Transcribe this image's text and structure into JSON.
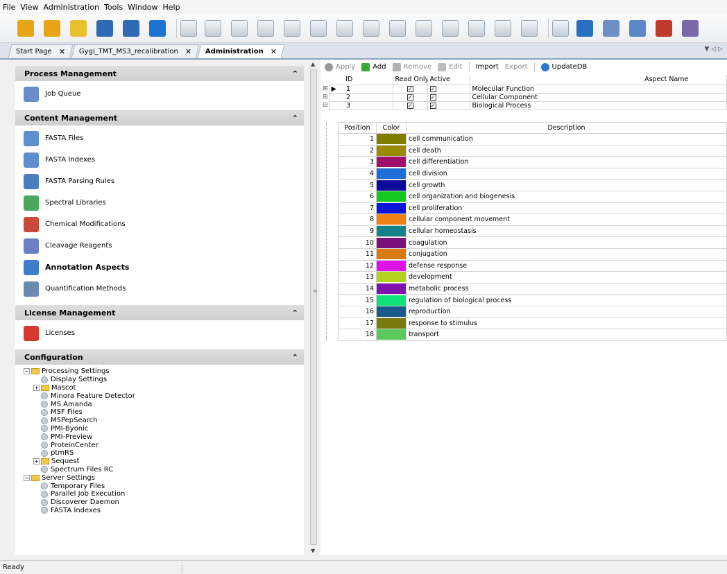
{
  "menu": [
    "File",
    "View",
    "Administration",
    "Tools",
    "Window",
    "Help"
  ],
  "toolbar_icons": [
    {
      "name": "open-study-icon",
      "color": "#e8a317"
    },
    {
      "name": "open-result-icon",
      "color": "#e8a317"
    },
    {
      "name": "open-folder-icon",
      "color": "#e8c030"
    },
    {
      "name": "save-icon",
      "color": "#2f6bb5"
    },
    {
      "name": "save-all-icon",
      "color": "#2f6bb5"
    },
    {
      "name": "home-icon",
      "color": "#1e73d2"
    },
    {
      "name": "calculator-icon",
      "color": "gray"
    },
    {
      "name": "filter-icon",
      "color": "gray"
    },
    {
      "name": "chart-1-icon",
      "color": "gray"
    },
    {
      "name": "chart-2-icon",
      "color": "gray"
    },
    {
      "name": "chart-3-icon",
      "color": "gray"
    },
    {
      "name": "eye-icon",
      "color": "gray"
    },
    {
      "name": "chart-4-icon",
      "color": "gray"
    },
    {
      "name": "chart-5-icon",
      "color": "gray"
    },
    {
      "name": "chart-6-icon",
      "color": "gray"
    },
    {
      "name": "chart-7-icon",
      "color": "gray"
    },
    {
      "name": "chart-8-icon",
      "color": "gray"
    },
    {
      "name": "chart-9-icon",
      "color": "gray"
    },
    {
      "name": "chart-10-icon",
      "color": "gray"
    },
    {
      "name": "chart-11-icon",
      "color": "gray"
    },
    {
      "name": "document-icon",
      "color": "gray"
    },
    {
      "name": "workflow-icon",
      "color": "#2a6fbf"
    },
    {
      "name": "job-queue-icon",
      "color": "#6d8fc7"
    },
    {
      "name": "fasta-files-icon",
      "color": "#5a88c8"
    },
    {
      "name": "chemical-mods-icon",
      "color": "#c0392b"
    },
    {
      "name": "cleavage-icon",
      "color": "#7a6aa8"
    }
  ],
  "tabs": [
    {
      "label": "Start Page",
      "active": false
    },
    {
      "label": "Gygi_TMT_MS3_recalibration",
      "active": false
    },
    {
      "label": "Administration",
      "active": true
    }
  ],
  "tab_close": "✕",
  "tab_nav": "▼ ◁ ▷",
  "collapse_glyph": "⌃",
  "sections": [
    {
      "title": "Process Management",
      "items": [
        {
          "label": "Job Queue",
          "icon": "job-queue-icon",
          "color": "#6a8cc9",
          "bold": false
        }
      ]
    },
    {
      "title": "Content Management",
      "items": [
        {
          "label": "FASTA Files",
          "icon": "fasta-files-icon",
          "color": "#5b8fd0",
          "bold": false
        },
        {
          "label": "FASTA Indexes",
          "icon": "fasta-indexes-icon",
          "color": "#5b8fd0",
          "bold": false
        },
        {
          "label": "FASTA Parsing Rules",
          "icon": "parsing-rules-icon",
          "color": "#4a7fbf",
          "bold": false
        },
        {
          "label": "Spectral Libraries",
          "icon": "spectral-libraries-icon",
          "color": "#4aa85c",
          "bold": false
        },
        {
          "label": "Chemical Modifications",
          "icon": "chemical-modifications-icon",
          "color": "#c94a3a",
          "bold": false
        },
        {
          "label": "Cleavage Reagents",
          "icon": "cleavage-reagents-icon",
          "color": "#6b7fc4",
          "bold": false
        },
        {
          "label": "Annotation Aspects",
          "icon": "annotation-aspects-icon",
          "color": "#3c7fc8",
          "bold": true
        },
        {
          "label": "Quantification Methods",
          "icon": "quantification-methods-icon",
          "color": "#6a8ab0",
          "bold": false
        }
      ]
    },
    {
      "title": "License Management",
      "items": [
        {
          "label": "Licenses",
          "icon": "licenses-ribbon-icon",
          "color": "#d63a2a",
          "bold": false
        }
      ]
    }
  ],
  "configuration": {
    "title": "Configuration",
    "tree": [
      {
        "label": "Processing Settings",
        "level": 0,
        "type": "folder",
        "expander": "⊟"
      },
      {
        "label": "Display Settings",
        "level": 1,
        "type": "gear",
        "expander": ""
      },
      {
        "label": "Mascot",
        "level": 1,
        "type": "folder",
        "expander": "⊞"
      },
      {
        "label": "Minora Feature Detector",
        "level": 1,
        "type": "gear",
        "expander": ""
      },
      {
        "label": "MS Amanda",
        "level": 1,
        "type": "gear",
        "expander": ""
      },
      {
        "label": "MSF Files",
        "level": 1,
        "type": "gear",
        "expander": ""
      },
      {
        "label": "MSPepSearch",
        "level": 1,
        "type": "gear",
        "expander": ""
      },
      {
        "label": "PMI-Byonic",
        "level": 1,
        "type": "gear",
        "expander": ""
      },
      {
        "label": "PMI-Preview",
        "level": 1,
        "type": "gear",
        "expander": ""
      },
      {
        "label": "ProteinCenter",
        "level": 1,
        "type": "gear",
        "expander": ""
      },
      {
        "label": "ptmRS",
        "level": 1,
        "type": "gear",
        "expander": ""
      },
      {
        "label": "Sequest",
        "level": 1,
        "type": "folder",
        "expander": "⊞"
      },
      {
        "label": "Spectrum Files RC",
        "level": 1,
        "type": "gear",
        "expander": ""
      },
      {
        "label": "Server Settings",
        "level": 0,
        "type": "folder",
        "expander": "⊟"
      },
      {
        "label": "Temporary Files",
        "level": 1,
        "type": "gear",
        "expander": ""
      },
      {
        "label": "Parallel Job Execution",
        "level": 1,
        "type": "gear",
        "expander": ""
      },
      {
        "label": "Discoverer Daemon",
        "level": 1,
        "type": "gear",
        "expander": ""
      },
      {
        "label": "FASTA Indexes",
        "level": 1,
        "type": "gear",
        "expander": ""
      }
    ]
  },
  "right_toolbar": {
    "apply": "Apply",
    "add": "Add",
    "remove": "Remove",
    "edit": "Edit",
    "import": "Import",
    "export": "Export",
    "updatedb": "UpdateDB"
  },
  "aspects_grid": {
    "headers": {
      "id": "ID",
      "read_only": "Read Only",
      "active": "Active",
      "aspect_name": "Aspect Name"
    },
    "rows": [
      {
        "expander": "⊞",
        "id": "1",
        "read_only": true,
        "active": true,
        "name": "Molecular Function",
        "current": true
      },
      {
        "expander": "⊞",
        "id": "2",
        "read_only": true,
        "active": true,
        "name": "Cellular Component",
        "current": false
      },
      {
        "expander": "⊟",
        "id": "3",
        "read_only": true,
        "active": true,
        "name": "Biological Process",
        "current": false
      }
    ],
    "check_glyph": "✓",
    "current_glyph": "▶"
  },
  "detail_grid": {
    "headers": {
      "position": "Position",
      "color": "Color",
      "description": "Description"
    },
    "rows": [
      {
        "position": "1",
        "color": "#807c00",
        "description": "cell communication"
      },
      {
        "position": "2",
        "color": "#9a8a00",
        "description": "cell death"
      },
      {
        "position": "3",
        "color": "#a01068",
        "description": "cell differentiation"
      },
      {
        "position": "4",
        "color": "#1e6ed8",
        "description": "cell division"
      },
      {
        "position": "5",
        "color": "#0a0a9a",
        "description": "cell growth"
      },
      {
        "position": "6",
        "color": "#12c81e",
        "description": "cell organization and biogenesis"
      },
      {
        "position": "7",
        "color": "#0a14d8",
        "description": "cell proliferation"
      },
      {
        "position": "8",
        "color": "#f08010",
        "description": "cellular component movement"
      },
      {
        "position": "9",
        "color": "#16808a",
        "description": "cellular homeostasis"
      },
      {
        "position": "10",
        "color": "#7a107a",
        "description": "coagulation"
      },
      {
        "position": "11",
        "color": "#d87a10",
        "description": "conjugation"
      },
      {
        "position": "12",
        "color": "#e010e8",
        "description": "defense response"
      },
      {
        "position": "13",
        "color": "#b4d21c",
        "description": "development"
      },
      {
        "position": "14",
        "color": "#8010b0",
        "description": "metabolic process"
      },
      {
        "position": "15",
        "color": "#10e07a",
        "description": "regulation of biological process"
      },
      {
        "position": "16",
        "color": "#1a5a8a",
        "description": "reproduction"
      },
      {
        "position": "17",
        "color": "#787a10",
        "description": "response to stimulus"
      },
      {
        "position": "18",
        "color": "#5ac85a",
        "description": "transport"
      }
    ]
  },
  "status": "Ready"
}
